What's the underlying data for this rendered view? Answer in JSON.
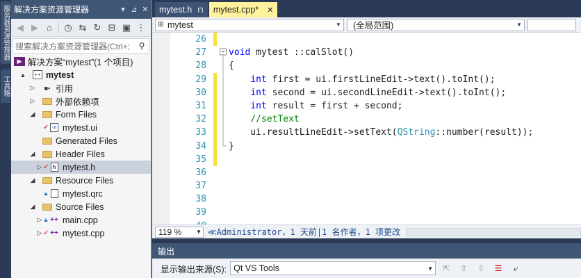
{
  "side_tabs": [
    "服务器资源管理器",
    "工具箱"
  ],
  "solution_explorer": {
    "title": "解决方案资源管理器",
    "title_buttons": [
      "▾",
      "⊿",
      "✕"
    ],
    "search_placeholder": "搜索解决方案资源管理器(Ctrl+;",
    "tree": [
      {
        "level": 0,
        "expander": "",
        "label": "解决方案“mytest”(1 个项目)",
        "icon": "solution-icon",
        "bold": false
      },
      {
        "level": 1,
        "expander": "▲",
        "label": "mytest",
        "icon": "project-icon",
        "bold": true
      },
      {
        "level": 2,
        "expander": "▷",
        "label": "引用",
        "icon": "references-icon"
      },
      {
        "level": 2,
        "expander": "▷",
        "label": "外部依赖项",
        "icon": "external-deps-icon"
      },
      {
        "level": 2,
        "expander": "◢",
        "label": "Form Files",
        "icon": "folder-icon"
      },
      {
        "level": 3,
        "expander": "",
        "label": "mytest.ui",
        "icon": "ui-file-icon",
        "check": true
      },
      {
        "level": 2,
        "expander": "",
        "label": "Generated Files",
        "icon": "folder-icon"
      },
      {
        "level": 2,
        "expander": "◢",
        "label": "Header Files",
        "icon": "folder-icon"
      },
      {
        "level": 3,
        "expander": "▷",
        "label": "mytest.h",
        "icon": "header-file-icon",
        "check": true,
        "selected": true
      },
      {
        "level": 2,
        "expander": "◢",
        "label": "Resource Files",
        "icon": "folder-icon"
      },
      {
        "level": 3,
        "expander": "",
        "label": "mytest.qrc",
        "icon": "file-icon",
        "lock": true
      },
      {
        "level": 2,
        "expander": "◢",
        "label": "Source Files",
        "icon": "folder-icon"
      },
      {
        "level": 3,
        "expander": "▷",
        "label": "main.cpp",
        "icon": "cpp-file-icon",
        "lock": true
      },
      {
        "level": 3,
        "expander": "▷",
        "label": "mytest.cpp",
        "icon": "cpp-file-icon",
        "check": true
      }
    ]
  },
  "editor": {
    "tabs": [
      {
        "label": "mytest.h",
        "marker": "⊓",
        "active": false
      },
      {
        "label": "mytest.cpp*",
        "marker": "✕",
        "active": true
      }
    ],
    "nav_left": "mytest",
    "nav_right": "(全局范围)",
    "line_start": 26,
    "lines": [
      "",
      "void mytest ::calSlot()",
      "{",
      "    int first = ui.firstLineEdit->text().toInt();",
      "    int second = ui.secondLineEdit->text().toInt();",
      "    int result = first + second;",
      "    //setText",
      "    ui.resultLineEdit->setText(QString::number(result));",
      "}",
      "",
      "",
      "",
      "",
      "",
      ""
    ],
    "zoom": "119 %",
    "codelens": "≪Administrator，1 天前|1 名作者，1 项更改"
  },
  "output": {
    "title": "输出",
    "source_label": "显示输出来源(S):",
    "source_value": "Qt VS Tools"
  },
  "colors": {
    "tab_active": "#fff29d",
    "title_bar": "#3f5674",
    "keyword": "#0000ff",
    "comment": "#008000",
    "line_number": "#2b91af",
    "change_bar": "#f5e23b"
  }
}
